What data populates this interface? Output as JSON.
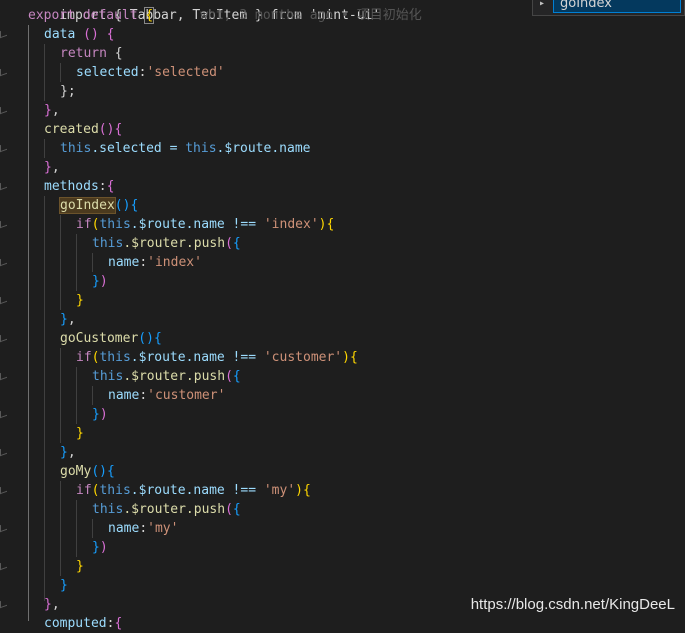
{
  "blame": "wht, 3 months ago • 项目初始化",
  "suggestion": {
    "label": "goIndex"
  },
  "watermark": "https://blog.csdn.net/KingDeeL",
  "code": {
    "l0_a": "import { Tabbar, TabItem } from 'mint-ui'",
    "l1_a": "export default ",
    "l1_b": "{",
    "l2_a": "data ",
    "l2_b": "()",
    "l2_c": " {",
    "l3_a": "return",
    "l3_b": " {",
    "l4_a": "selected",
    "l4_b": ":",
    "l4_c": "'selected'",
    "l5_a": "}",
    "l5_b": ";",
    "l6_a": "}",
    "l6_b": ",",
    "l7_a": "created",
    "l7_b": "()",
    "l7_c": "{",
    "l8_a": "this",
    "l8_b": ".selected = ",
    "l8_c": "this",
    "l8_d": ".$route.name",
    "l9_a": "}",
    "l9_b": ",",
    "l10_a": "methods",
    "l10_b": ":",
    "l10_c": "{",
    "l11_a": "goIndex",
    "l11_b": "()",
    "l11_c": "{",
    "l12_a": "if",
    "l12_b": "(",
    "l12_c": "this",
    "l12_d": ".$route.name !== ",
    "l12_e": "'index'",
    "l12_f": ")",
    "l12_g": "{",
    "l13_a": "this",
    "l13_b": ".$router.push",
    "l13_c": "(",
    "l13_d": "{",
    "l14_a": "name",
    "l14_b": ":",
    "l14_c": "'index'",
    "l15_a": "}",
    "l15_b": ")",
    "l16_a": "}",
    "l17_a": "}",
    "l17_b": ",",
    "l18_a": "goCustomer",
    "l18_b": "()",
    "l18_c": "{",
    "l19_a": "if",
    "l19_b": "(",
    "l19_c": "this",
    "l19_d": ".$route.name !== ",
    "l19_e": "'customer'",
    "l19_f": ")",
    "l19_g": "{",
    "l20_a": "this",
    "l20_b": ".$router.push",
    "l20_c": "(",
    "l20_d": "{",
    "l21_a": "name",
    "l21_b": ":",
    "l21_c": "'customer'",
    "l22_a": "}",
    "l22_b": ")",
    "l23_a": "}",
    "l24_a": "}",
    "l24_b": ",",
    "l25_a": "goMy",
    "l25_b": "()",
    "l25_c": "{",
    "l26_a": "if",
    "l26_b": "(",
    "l26_c": "this",
    "l26_d": ".$route.name !== ",
    "l26_e": "'my'",
    "l26_f": ")",
    "l26_g": "{",
    "l27_a": "this",
    "l27_b": ".$router.push",
    "l27_c": "(",
    "l27_d": "{",
    "l28_a": "name",
    "l28_b": ":",
    "l28_c": "'my'",
    "l29_a": "}",
    "l29_b": ")",
    "l30_a": "}",
    "l31_a": "}",
    "l32_a": "}",
    "l32_b": ",",
    "l33_a": "computed",
    "l33_b": ":",
    "l33_c": "{"
  }
}
